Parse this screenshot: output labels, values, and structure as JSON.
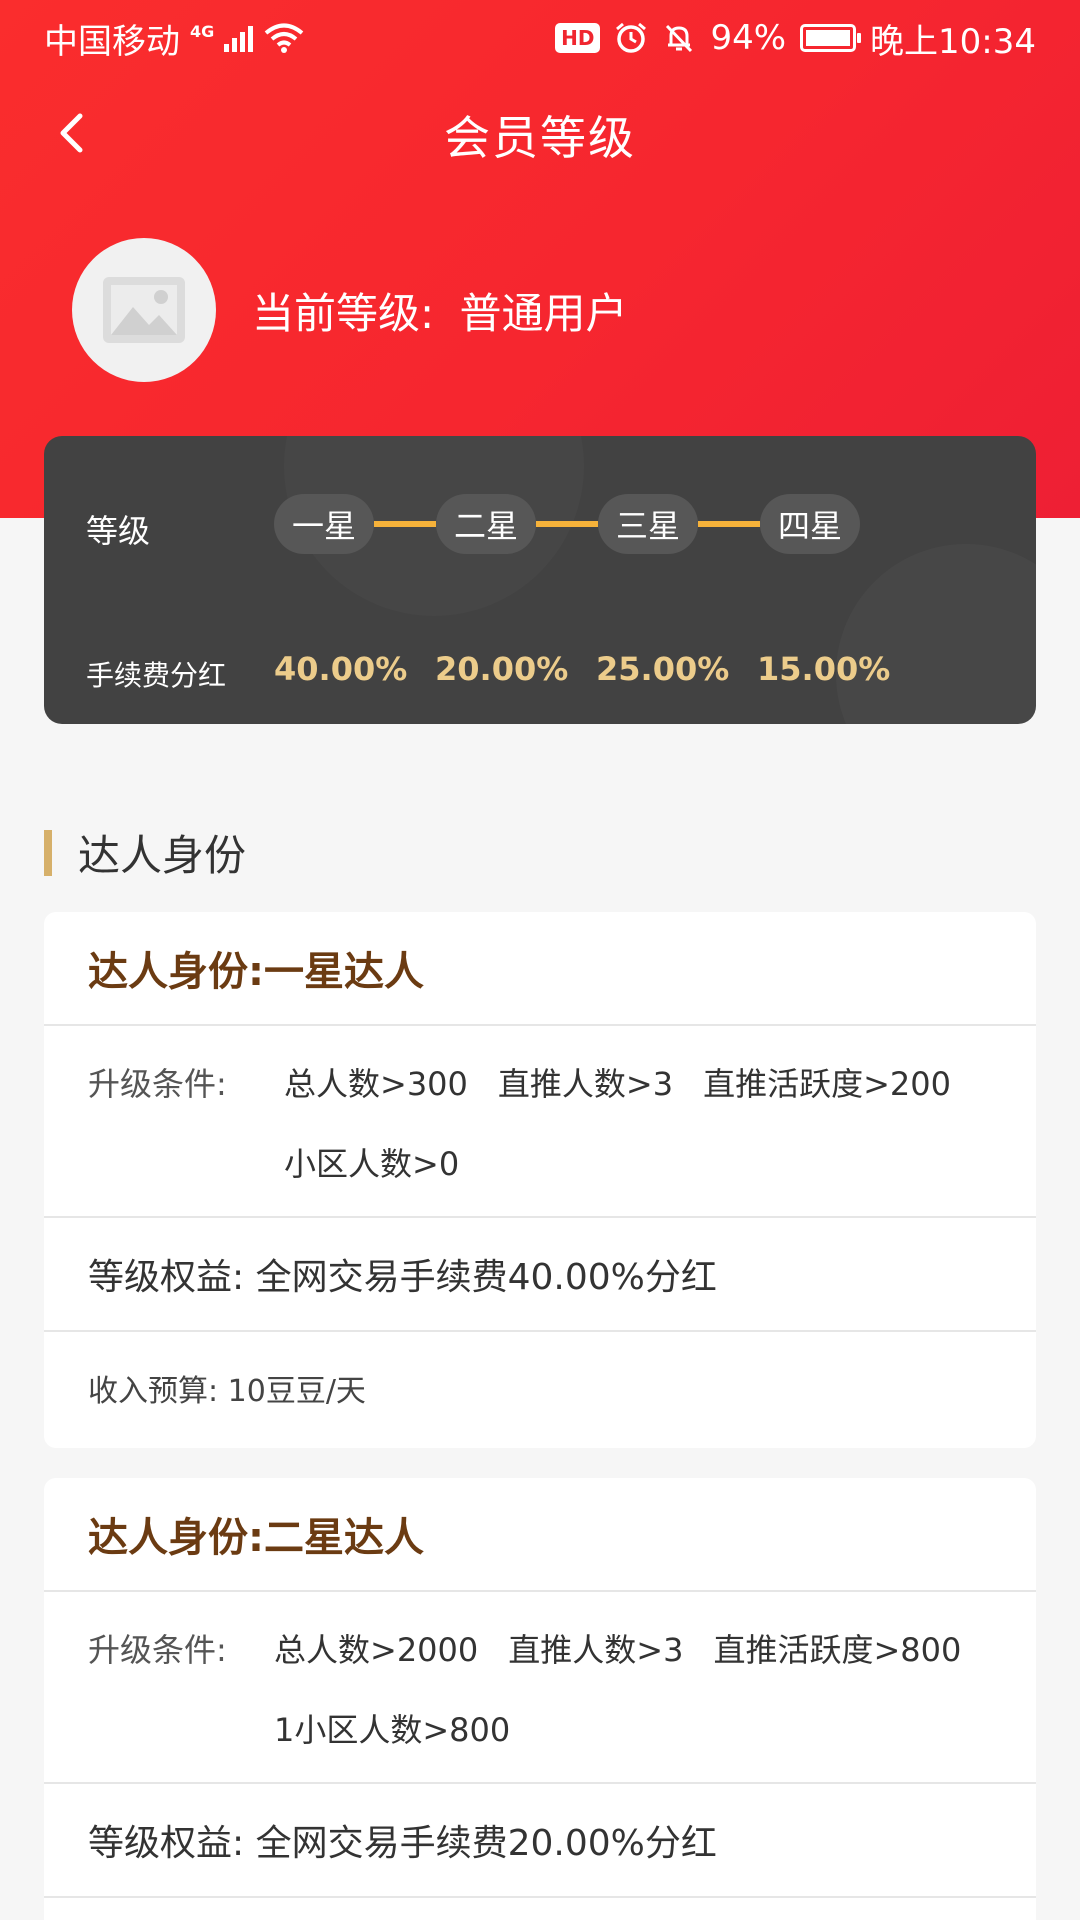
{
  "status_bar": {
    "carrier": "中国移动",
    "network": "4G",
    "battery_percent": "94%",
    "time": "晚上10:34",
    "hd_badge": "HD"
  },
  "nav": {
    "title": "会员等级",
    "back_icon": "chevron-left-icon"
  },
  "profile": {
    "current_level_label": "当前等级:",
    "current_level_value": "普通用户",
    "avatar_icon": "image-placeholder-icon"
  },
  "level_card": {
    "level_label": "等级",
    "fee_label": "手续费分红",
    "levels": [
      "一星",
      "二星",
      "三星",
      "四星"
    ],
    "fees": [
      "40.00%",
      "20.00%",
      "25.00%",
      "15.00%"
    ],
    "connector_color": "#f6b23a",
    "fee_color": "#eccc8b"
  },
  "section": {
    "title": "达人身份",
    "accent_color": "#d6b06a"
  },
  "cards": [
    {
      "title": "达人身份:一星达人",
      "condition_label": "升级条件:",
      "conditions": [
        "总人数>300",
        "直推人数>3",
        "直推活跃度>200",
        "小区人数>0"
      ],
      "benefit": "等级权益: 全网交易手续费40.00%分红",
      "income": "收入预算: 10豆豆/天"
    },
    {
      "title": "达人身份:二星达人",
      "condition_label": "升级条件:",
      "conditions": [
        "总人数>2000",
        "直推人数>3",
        "直推活跃度>800",
        "1小区人数>800"
      ],
      "benefit": "等级权益: 全网交易手续费20.00%分红"
    }
  ]
}
